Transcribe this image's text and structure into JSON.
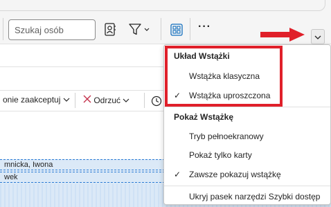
{
  "ribbon": {
    "search_placeholder": "Szukaj osób",
    "more_label": "···"
  },
  "actions": {
    "tentative_label": "onie zaakceptuj",
    "decline_label": "Odrzuć"
  },
  "rows": [
    {
      "text": "mnicka, Iwona"
    },
    {
      "text": "wek"
    }
  ],
  "menu": {
    "section1_heading": "Układ Wstążki",
    "item_classic": "Wstążka klasyczna",
    "item_simplified": "Wstążka uproszczona",
    "section2_heading": "Pokaż Wstążkę",
    "item_fullscreen": "Tryb pełnoekranowy",
    "item_tabs_only": "Pokaż tylko karty",
    "item_always_show": "Zawsze pokazuj wstążkę",
    "item_hide_qat": "Ukryj pasek narzędzi Szybki dostęp",
    "checkmark": "✓"
  },
  "colors": {
    "highlight": "#e0202a",
    "accent_blue": "#0f6cbd",
    "selection": "#dbe9f7"
  }
}
